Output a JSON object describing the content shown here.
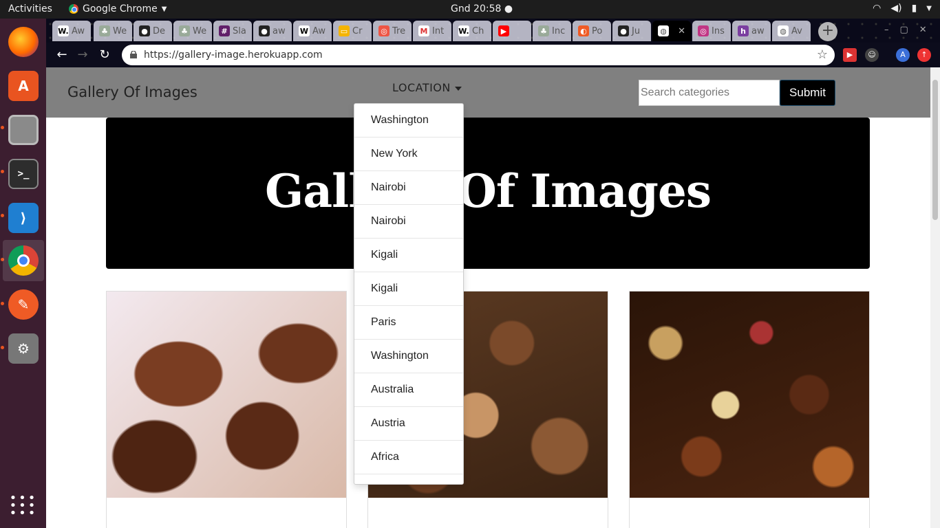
{
  "os": {
    "activities": "Activities",
    "app_name": "Google Chrome",
    "clock": "Gnd 20:58"
  },
  "tabs": [
    {
      "label": "Aw",
      "icon": "W."
    },
    {
      "label": "We",
      "icon": "tree"
    },
    {
      "label": "De",
      "icon": "github"
    },
    {
      "label": "We",
      "icon": "tree"
    },
    {
      "label": "Sla",
      "icon": "slack"
    },
    {
      "label": "aw",
      "icon": "github"
    },
    {
      "label": "Aw",
      "icon": "W"
    },
    {
      "label": "Cr",
      "icon": "slides"
    },
    {
      "label": "Tre",
      "icon": "trello"
    },
    {
      "label": "Int",
      "icon": "gmail"
    },
    {
      "label": "Ch",
      "icon": "W."
    },
    {
      "label": "",
      "icon": "youtube"
    },
    {
      "label": "Inc",
      "icon": "tree"
    },
    {
      "label": "Po",
      "icon": "postman"
    },
    {
      "label": "Ju",
      "icon": "github"
    },
    {
      "label": "",
      "icon": "globe"
    },
    {
      "label": "Ins",
      "icon": "instagram"
    },
    {
      "label": "aw",
      "icon": "h"
    },
    {
      "label": "Av",
      "icon": "globe"
    }
  ],
  "browser": {
    "url": "https://gallery-image.herokuapp.com",
    "profile_initial": "A"
  },
  "page": {
    "brand": "Gallery Of Images",
    "location_label": "LOCATION",
    "search_placeholder": "Search categories",
    "submit_label": "Submit",
    "hero_title": "Gallery Of Images",
    "locations": [
      "Washington",
      "New York",
      "Nairobi",
      "Nairobi",
      "Kigali",
      "Kigali",
      "Paris",
      "Washington",
      "Australia",
      "Austria",
      "Africa"
    ]
  }
}
